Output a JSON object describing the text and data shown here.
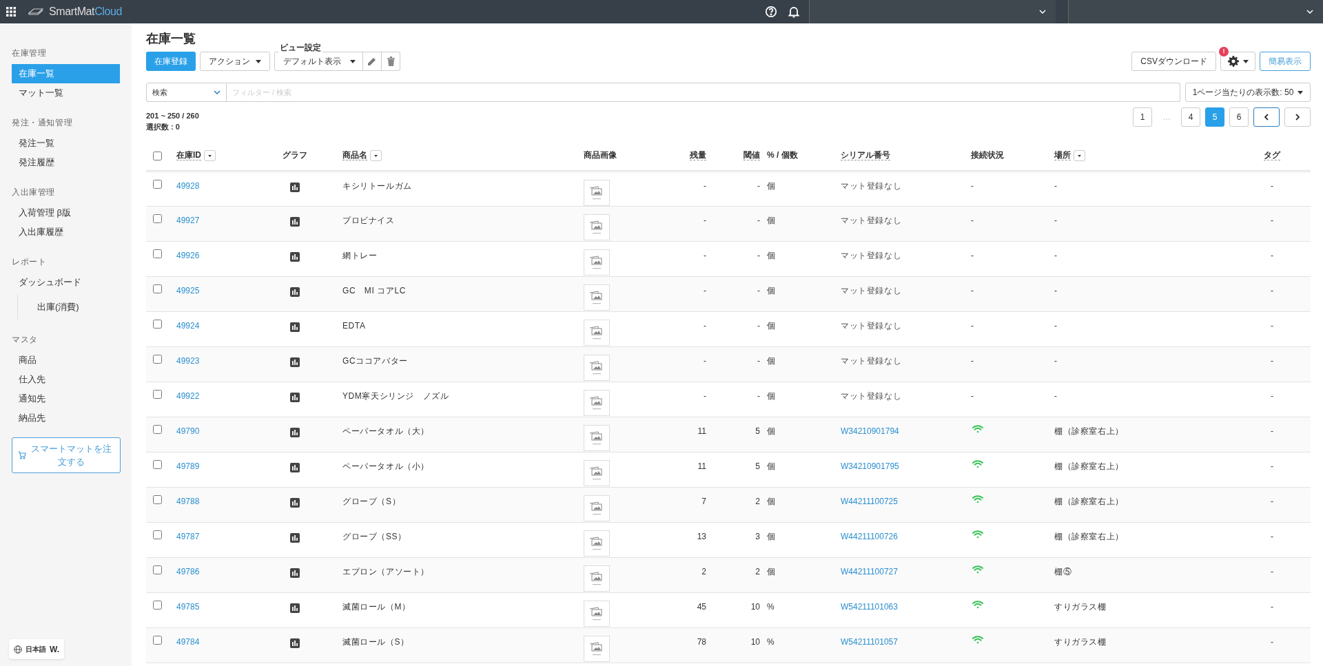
{
  "brand": {
    "name": "SmartMat",
    "suffix": "Cloud"
  },
  "sidebar": {
    "sections": [
      {
        "title": "在庫管理",
        "items": [
          {
            "label": "在庫一覧",
            "selected": true,
            "sub": false
          },
          {
            "label": "マット一覧",
            "selected": false,
            "sub": false
          }
        ]
      },
      {
        "title": "発注・通知管理",
        "items": [
          {
            "label": "発注一覧",
            "selected": false,
            "sub": false
          },
          {
            "label": "発注履歴",
            "selected": false,
            "sub": false
          }
        ]
      },
      {
        "title": "入出庫管理",
        "items": [
          {
            "label": "入荷管理 β版",
            "selected": false,
            "sub": false
          },
          {
            "label": "入出庫履歴",
            "selected": false,
            "sub": false
          }
        ]
      },
      {
        "title": "レポート",
        "items": [
          {
            "label": "ダッシュボード",
            "selected": false,
            "sub": false
          },
          {
            "label": "出庫(消費)",
            "selected": false,
            "sub": true
          }
        ]
      },
      {
        "title": "マスタ",
        "items": [
          {
            "label": "商品",
            "selected": false,
            "sub": false
          },
          {
            "label": "仕入先",
            "selected": false,
            "sub": false
          },
          {
            "label": "通知先",
            "selected": false,
            "sub": false
          },
          {
            "label": "納品先",
            "selected": false,
            "sub": false
          }
        ]
      }
    ],
    "order_button": "スマートマットを注文する",
    "language": "日本語",
    "language_logo": "W."
  },
  "page": {
    "title": "在庫一覧",
    "register_button": "在庫登録",
    "action_button": "アクション",
    "view_label": "ビュー設定",
    "view_value": "デフォルト表示",
    "csv_button": "CSVダウンロード",
    "settings_alert": "!",
    "simple_button": "簡易表示",
    "search_select": "検索",
    "filter_placeholder": "フィルター / 検索",
    "per_page": "1ページ当たりの表示数: 50",
    "range": "201 ~ 250 / 260",
    "selected_count": "選択数 : 0",
    "pages": [
      {
        "kind": "page",
        "label": "1",
        "selected": false
      },
      {
        "kind": "gap",
        "label": "…"
      },
      {
        "kind": "page",
        "label": "4",
        "selected": false
      },
      {
        "kind": "page",
        "label": "5",
        "selected": true
      },
      {
        "kind": "page",
        "label": "6",
        "selected": false
      }
    ]
  },
  "table": {
    "select_all_checked": false,
    "columns": [
      {
        "label": "在庫ID",
        "kind": "sortable"
      },
      {
        "label": "グラフ",
        "kind": "plain"
      },
      {
        "label": "商品名",
        "kind": "sortable"
      },
      {
        "label": "商品画像",
        "kind": "plain"
      },
      {
        "label": "残量",
        "kind": "plain"
      },
      {
        "label": "閾値",
        "kind": "plain"
      },
      {
        "label": "% / 個数",
        "kind": "plain"
      },
      {
        "label": "シリアル番号",
        "kind": "plain"
      },
      {
        "label": "接続状況",
        "kind": "plain"
      },
      {
        "label": "場所",
        "kind": "sortable"
      },
      {
        "label": "タグ",
        "kind": "plain"
      }
    ],
    "rows": [
      {
        "checked": false,
        "id": "49928",
        "name": "キシリトールガム",
        "remaining": "-",
        "threshold": "-",
        "unit": "個",
        "serial": "マット登録なし",
        "serial_registered": false,
        "online": false,
        "connection": "-",
        "location": "-",
        "tag": "-"
      },
      {
        "checked": false,
        "id": "49927",
        "name": "プロビナイス",
        "remaining": "-",
        "threshold": "-",
        "unit": "個",
        "serial": "マット登録なし",
        "serial_registered": false,
        "online": false,
        "connection": "-",
        "location": "-",
        "tag": "-"
      },
      {
        "checked": false,
        "id": "49926",
        "name": "網トレー",
        "remaining": "-",
        "threshold": "-",
        "unit": "個",
        "serial": "マット登録なし",
        "serial_registered": false,
        "online": false,
        "connection": "-",
        "location": "-",
        "tag": "-"
      },
      {
        "checked": false,
        "id": "49925",
        "name": "GC　MI コアLC",
        "remaining": "-",
        "threshold": "-",
        "unit": "個",
        "serial": "マット登録なし",
        "serial_registered": false,
        "online": false,
        "connection": "-",
        "location": "-",
        "tag": "-"
      },
      {
        "checked": false,
        "id": "49924",
        "name": "EDTA",
        "remaining": "-",
        "threshold": "-",
        "unit": "個",
        "serial": "マット登録なし",
        "serial_registered": false,
        "online": false,
        "connection": "-",
        "location": "-",
        "tag": "-"
      },
      {
        "checked": false,
        "id": "49923",
        "name": "GCココアバター",
        "remaining": "-",
        "threshold": "-",
        "unit": "個",
        "serial": "マット登録なし",
        "serial_registered": false,
        "online": false,
        "connection": "-",
        "location": "-",
        "tag": "-"
      },
      {
        "checked": false,
        "id": "49922",
        "name": "YDM寒天シリンジ　ノズル",
        "remaining": "-",
        "threshold": "-",
        "unit": "個",
        "serial": "マット登録なし",
        "serial_registered": false,
        "online": false,
        "connection": "-",
        "location": "-",
        "tag": "-"
      },
      {
        "checked": false,
        "id": "49790",
        "name": "ペーパータオル（大）",
        "remaining": "11",
        "threshold": "5",
        "unit": "個",
        "serial": "W34210901794",
        "serial_registered": true,
        "online": true,
        "location": "棚（診察室右上）",
        "tag": "-"
      },
      {
        "checked": false,
        "id": "49789",
        "name": "ペーパータオル（小）",
        "remaining": "11",
        "threshold": "5",
        "unit": "個",
        "serial": "W34210901795",
        "serial_registered": true,
        "online": true,
        "location": "棚（診察室右上）",
        "tag": "-"
      },
      {
        "checked": false,
        "id": "49788",
        "name": "グローブ（S）",
        "remaining": "7",
        "threshold": "2",
        "unit": "個",
        "serial": "W44211100725",
        "serial_registered": true,
        "online": true,
        "location": "棚（診察室右上）",
        "tag": "-"
      },
      {
        "checked": false,
        "id": "49787",
        "name": "グローブ（SS）",
        "remaining": "13",
        "threshold": "3",
        "unit": "個",
        "serial": "W44211100726",
        "serial_registered": true,
        "online": true,
        "location": "棚（診察室右上）",
        "tag": "-"
      },
      {
        "checked": false,
        "id": "49786",
        "name": "エプロン（アソート）",
        "remaining": "2",
        "threshold": "2",
        "unit": "個",
        "serial": "W44211100727",
        "serial_registered": true,
        "online": true,
        "location": "棚⑤",
        "tag": "-"
      },
      {
        "checked": false,
        "id": "49785",
        "name": "滅菌ロール（M）",
        "remaining": "45",
        "threshold": "10",
        "unit": "%",
        "serial": "W54211101063",
        "serial_registered": true,
        "online": true,
        "location": "すりガラス棚",
        "tag": "-"
      },
      {
        "checked": false,
        "id": "49784",
        "name": "滅菌ロール（S）",
        "remaining": "78",
        "threshold": "10",
        "unit": "%",
        "serial": "W54211101057",
        "serial_registered": true,
        "online": true,
        "location": "すりガラス棚",
        "tag": "-"
      }
    ]
  }
}
